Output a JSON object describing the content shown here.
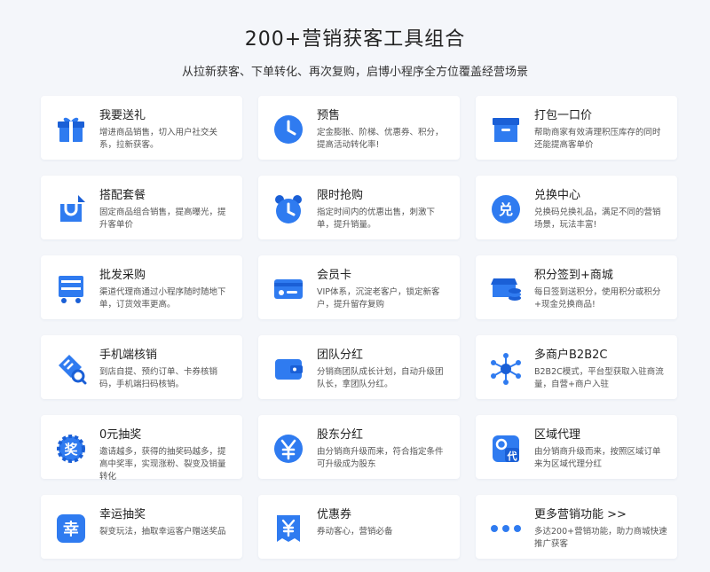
{
  "header": {
    "title": "200+营销获客工具组合",
    "subtitle": "从拉新获客、下单转化、再次复购，启博小程序全方位覆盖经营场景"
  },
  "colors": {
    "accent": "#2f7bf0",
    "accent_dark": "#1a5fd6",
    "background": "#f4f6fa",
    "card": "#ffffff"
  },
  "cards": [
    {
      "title": "我要送礼",
      "desc": "增进商品销售，切入用户社交关系，拉新获客。",
      "icon": "gift-icon"
    },
    {
      "title": "预售",
      "desc": "定金膨胀、阶梯、优惠券、积分，提高活动转化率!",
      "icon": "clock-icon"
    },
    {
      "title": "打包一口价",
      "desc": "帮助商家有效清理积压库存的同时还能提高客单价",
      "icon": "box-icon"
    },
    {
      "title": "搭配套餐",
      "desc": "固定商品组合销售，提高曝光，提升客单价",
      "icon": "bag-icon"
    },
    {
      "title": "限时抢购",
      "desc": "指定时间内的优惠出售，刺激下单，提升销量。",
      "icon": "alarm-clock-icon"
    },
    {
      "title": "兑换中心",
      "desc": "兑换码兑换礼品，满足不同的营销场景，玩法丰富!",
      "icon": "exchange-badge-icon",
      "glyph": "兑"
    },
    {
      "title": "批发采购",
      "desc": "渠道代理商通过小程序随时随地下单，订货效率更高。",
      "icon": "shelf-cart-icon"
    },
    {
      "title": "会员卡",
      "desc": "VIP体系，沉淀老客户，锁定新客户，提升留存复购",
      "icon": "member-card-icon"
    },
    {
      "title": "积分签到+商城",
      "desc": "每日签到送积分，使用积分或积分+现金兑换商品!",
      "icon": "store-coins-icon"
    },
    {
      "title": "手机端核销",
      "desc": "到店自提、预约订单、卡券核销码，手机端扫码核销。",
      "icon": "ticket-scan-icon"
    },
    {
      "title": "团队分红",
      "desc": "分销商团队成长计划，自动升级团队长，拿团队分红。",
      "icon": "wallet-icon"
    },
    {
      "title": "多商户B2B2C",
      "desc": "B2B2C模式，平台型获取入驻商流量，自营+商户入驻",
      "icon": "network-icon"
    },
    {
      "title": "0元抽奖",
      "desc": "邀请越多，获得的抽奖码越多，提高中奖率，实现涨粉、裂变及销量转化",
      "icon": "lottery-gear-icon",
      "glyph": "奖"
    },
    {
      "title": "股东分红",
      "desc": "由分销商升级而来，符合指定条件可升级成为股东",
      "icon": "yen-coin-icon"
    },
    {
      "title": "区域代理",
      "desc": "由分销商升级而来，按照区域订单来为区域代理分红",
      "icon": "agent-badge-icon",
      "glyph": "代"
    },
    {
      "title": "幸运抽奖",
      "desc": "裂变玩法，抽取幸运客户赠送奖品",
      "icon": "lucky-badge-icon",
      "glyph": "幸"
    },
    {
      "title": "优惠券",
      "desc": "券动客心，营销必备",
      "icon": "coupon-icon"
    },
    {
      "title": "更多营销功能 >>",
      "desc": "多达200+营销功能，助力商城快速推广获客",
      "icon": "more-dots-icon"
    }
  ]
}
